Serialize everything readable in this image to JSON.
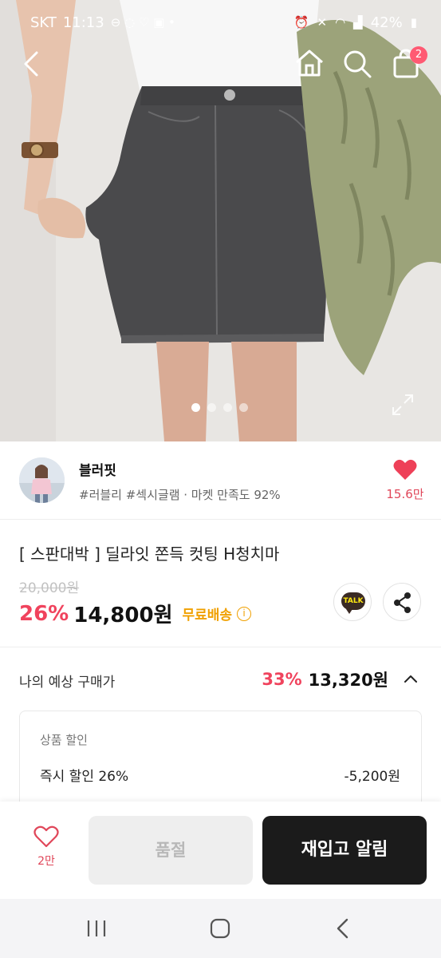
{
  "status_bar": {
    "carrier": "SKT",
    "time": "11:13",
    "battery": "42%"
  },
  "top_nav": {
    "cart_count": "2"
  },
  "hero": {
    "total_images": 4,
    "current_index": 1
  },
  "shop": {
    "name": "블러핏",
    "tags": "#러블리 #섹시글램 · 마켓 만족도 92%",
    "likes": "15.6만"
  },
  "product": {
    "title": "[ 스판대박 ] 딜라잇 쫀득 컷팅 H청치마",
    "original_price": "20,000원",
    "discount_rate": "26%",
    "price": "14,800원",
    "shipping": "무료배송",
    "info_icon": "i",
    "talk_label": "TALK"
  },
  "expected_price": {
    "label": "나의 예상 구매가",
    "rate": "33%",
    "price": "13,320원"
  },
  "discount_detail": {
    "title": "상품 할인",
    "items": [
      {
        "label": "즉시 할인 26%",
        "amount": "-5,200원"
      }
    ]
  },
  "action_bar": {
    "wish_count": "2만",
    "soldout_label": "품절",
    "restock_label": "재입고 알림"
  },
  "colors": {
    "accent_red": "#f0435d",
    "free_ship": "#f0a000",
    "badge": "#ff5a73"
  }
}
